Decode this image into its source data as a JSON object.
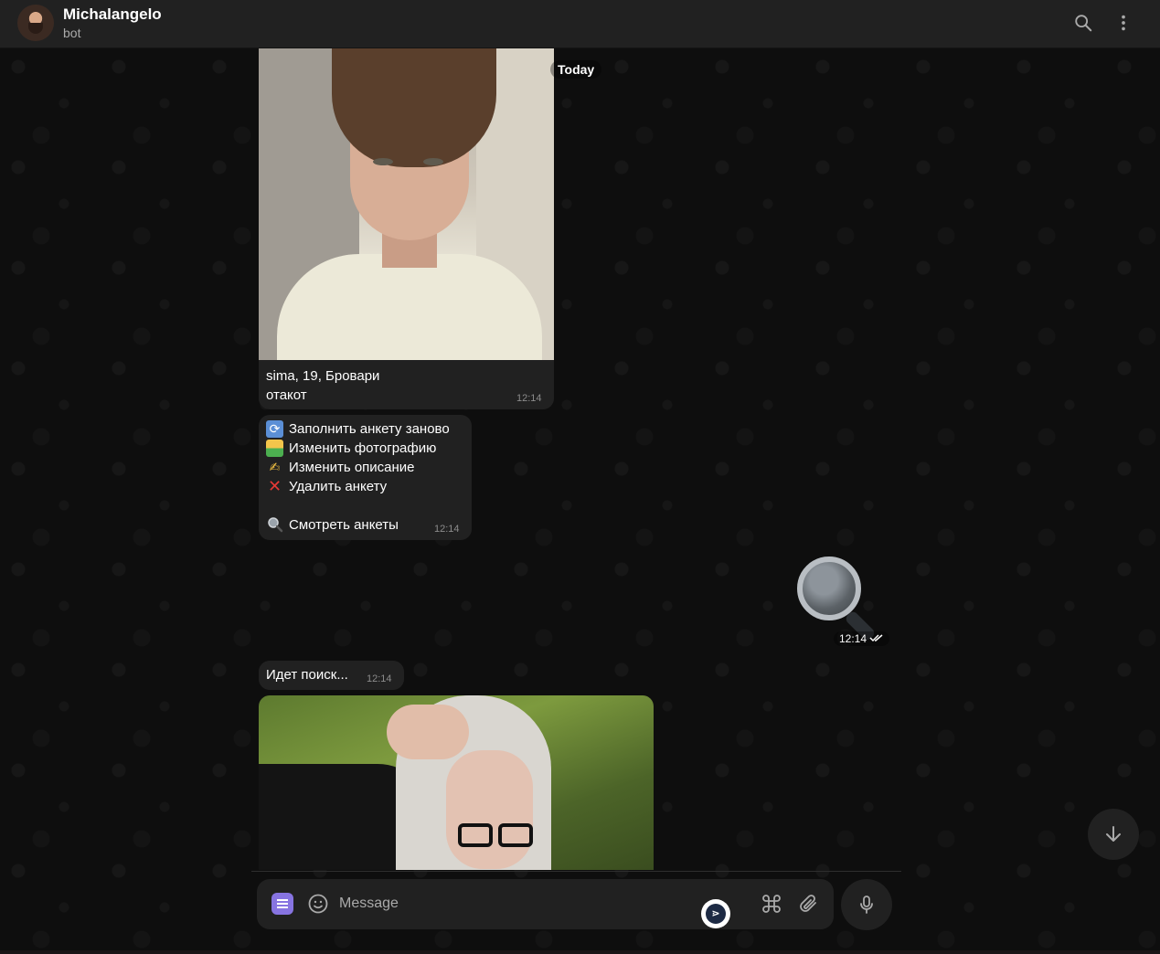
{
  "header": {
    "title": "Michalangelo",
    "subtitle": "bot",
    "search_icon": "search-icon",
    "more_icon": "more-vertical-icon"
  },
  "chat": {
    "date_label": "Today",
    "messages": {
      "profile": {
        "caption_line1": "sima, 19, Бровари",
        "caption_line2": "отакот",
        "time": "12:14"
      },
      "menu": {
        "items": [
          {
            "icon": "arrows-cycle-icon",
            "label": "Заполнить анкету заново"
          },
          {
            "icon": "picture-icon",
            "label": "Изменить фотографию"
          },
          {
            "icon": "writing-hand-icon",
            "label": "Изменить описание"
          },
          {
            "icon": "red-cross-icon",
            "label": "Удалить анкету"
          },
          {
            "icon": "magnifier-icon",
            "label": "Смотреть анкеты"
          }
        ],
        "time": "12:14"
      },
      "sticker": {
        "icon": "magnifier-sticker",
        "time": "12:14"
      },
      "searching": {
        "text": "Идет поиск...",
        "time": "12:14"
      }
    }
  },
  "composer": {
    "placeholder": "Message",
    "bot_menu_icon": "bot-menu-icon",
    "emoji_icon": "emoji-icon",
    "command_icon": "command-icon",
    "attach_icon": "paperclip-icon",
    "mic_icon": "microphone-icon",
    "extension_icon": "extension-badge-icon"
  },
  "colors": {
    "header_bg": "#212121",
    "bubble_bg": "#212121",
    "accent": "#8774e1",
    "background": "#0f0f0f"
  }
}
